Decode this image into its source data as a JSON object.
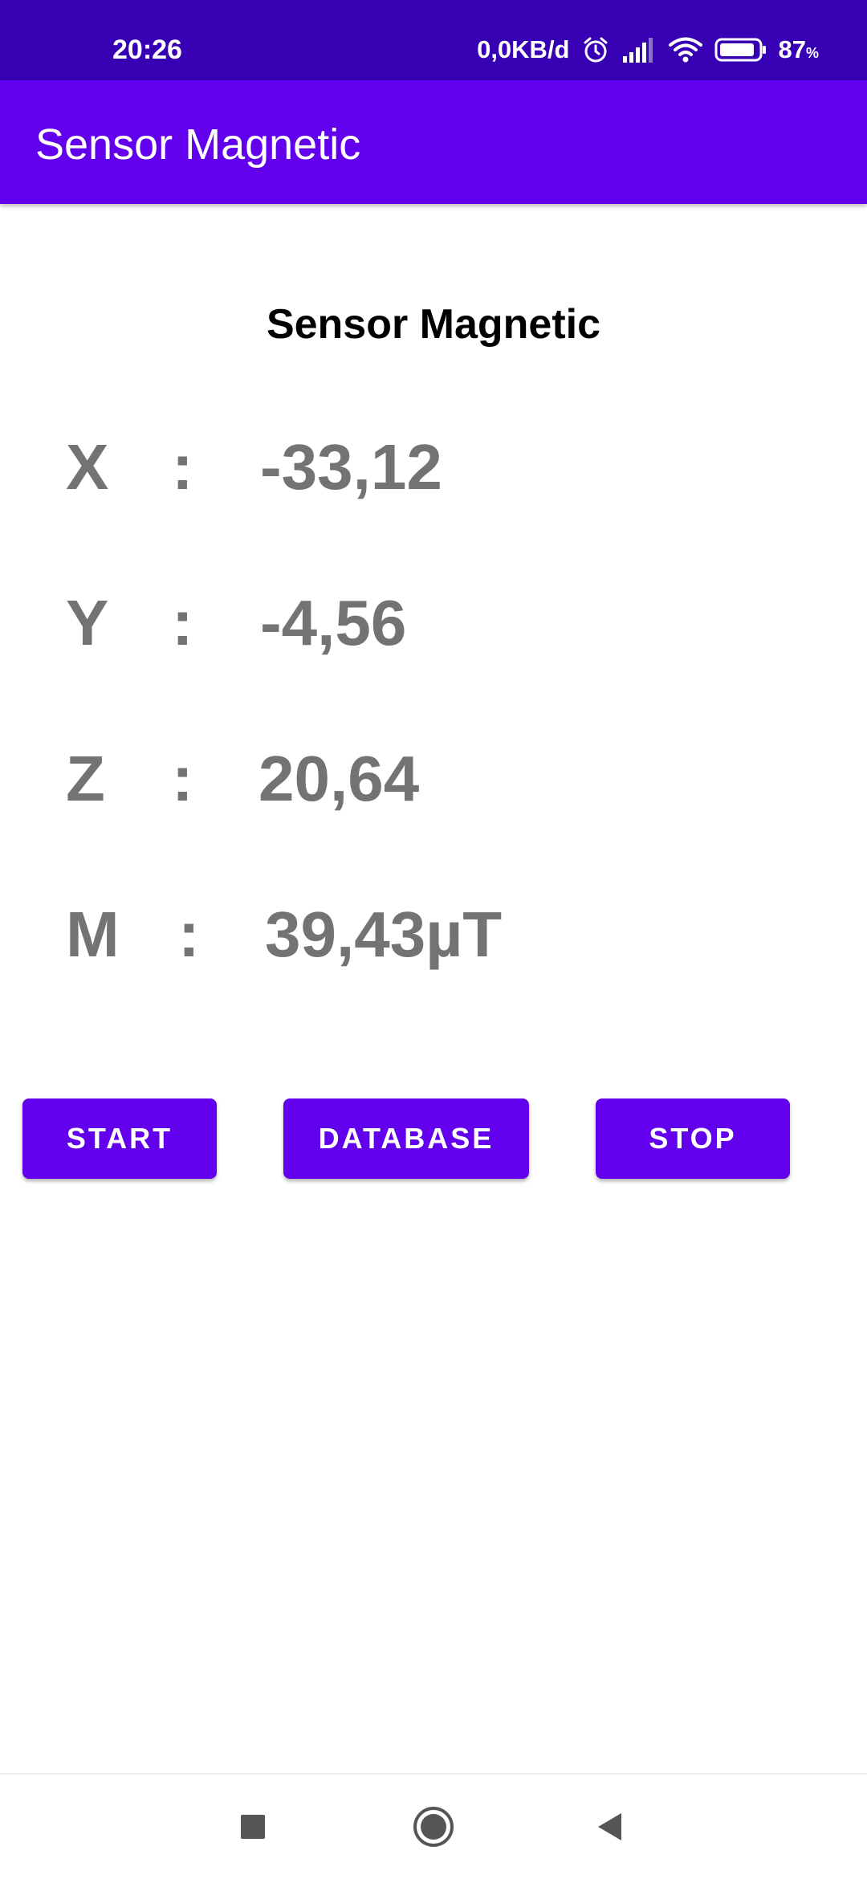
{
  "status_bar": {
    "time": "20:26",
    "network_speed": "0,0KB/d",
    "battery_percent": "87",
    "battery_unit": "%",
    "icons": [
      "alarm-icon",
      "signal-icon",
      "wifi-icon",
      "battery-icon"
    ]
  },
  "app_bar": {
    "title": "Sensor Magnetic"
  },
  "main": {
    "title": "Sensor Magnetic",
    "readings": [
      {
        "label": "X",
        "separator": ":",
        "value": "-33,12"
      },
      {
        "label": "Y",
        "separator": ":",
        "value": "-4,56"
      },
      {
        "label": "Z",
        "separator": ":",
        "value": "20,64"
      },
      {
        "label": "M",
        "separator": ":",
        "value": "39,43µT"
      }
    ],
    "buttons": {
      "start": "START",
      "database": "DATABASE",
      "stop": "STOP"
    }
  },
  "nav_bar": {
    "icons": [
      "recents-icon",
      "home-icon",
      "back-icon"
    ]
  },
  "colors": {
    "status_bar": "#3700b3",
    "primary": "#6200ee",
    "reading_text": "#737373"
  }
}
